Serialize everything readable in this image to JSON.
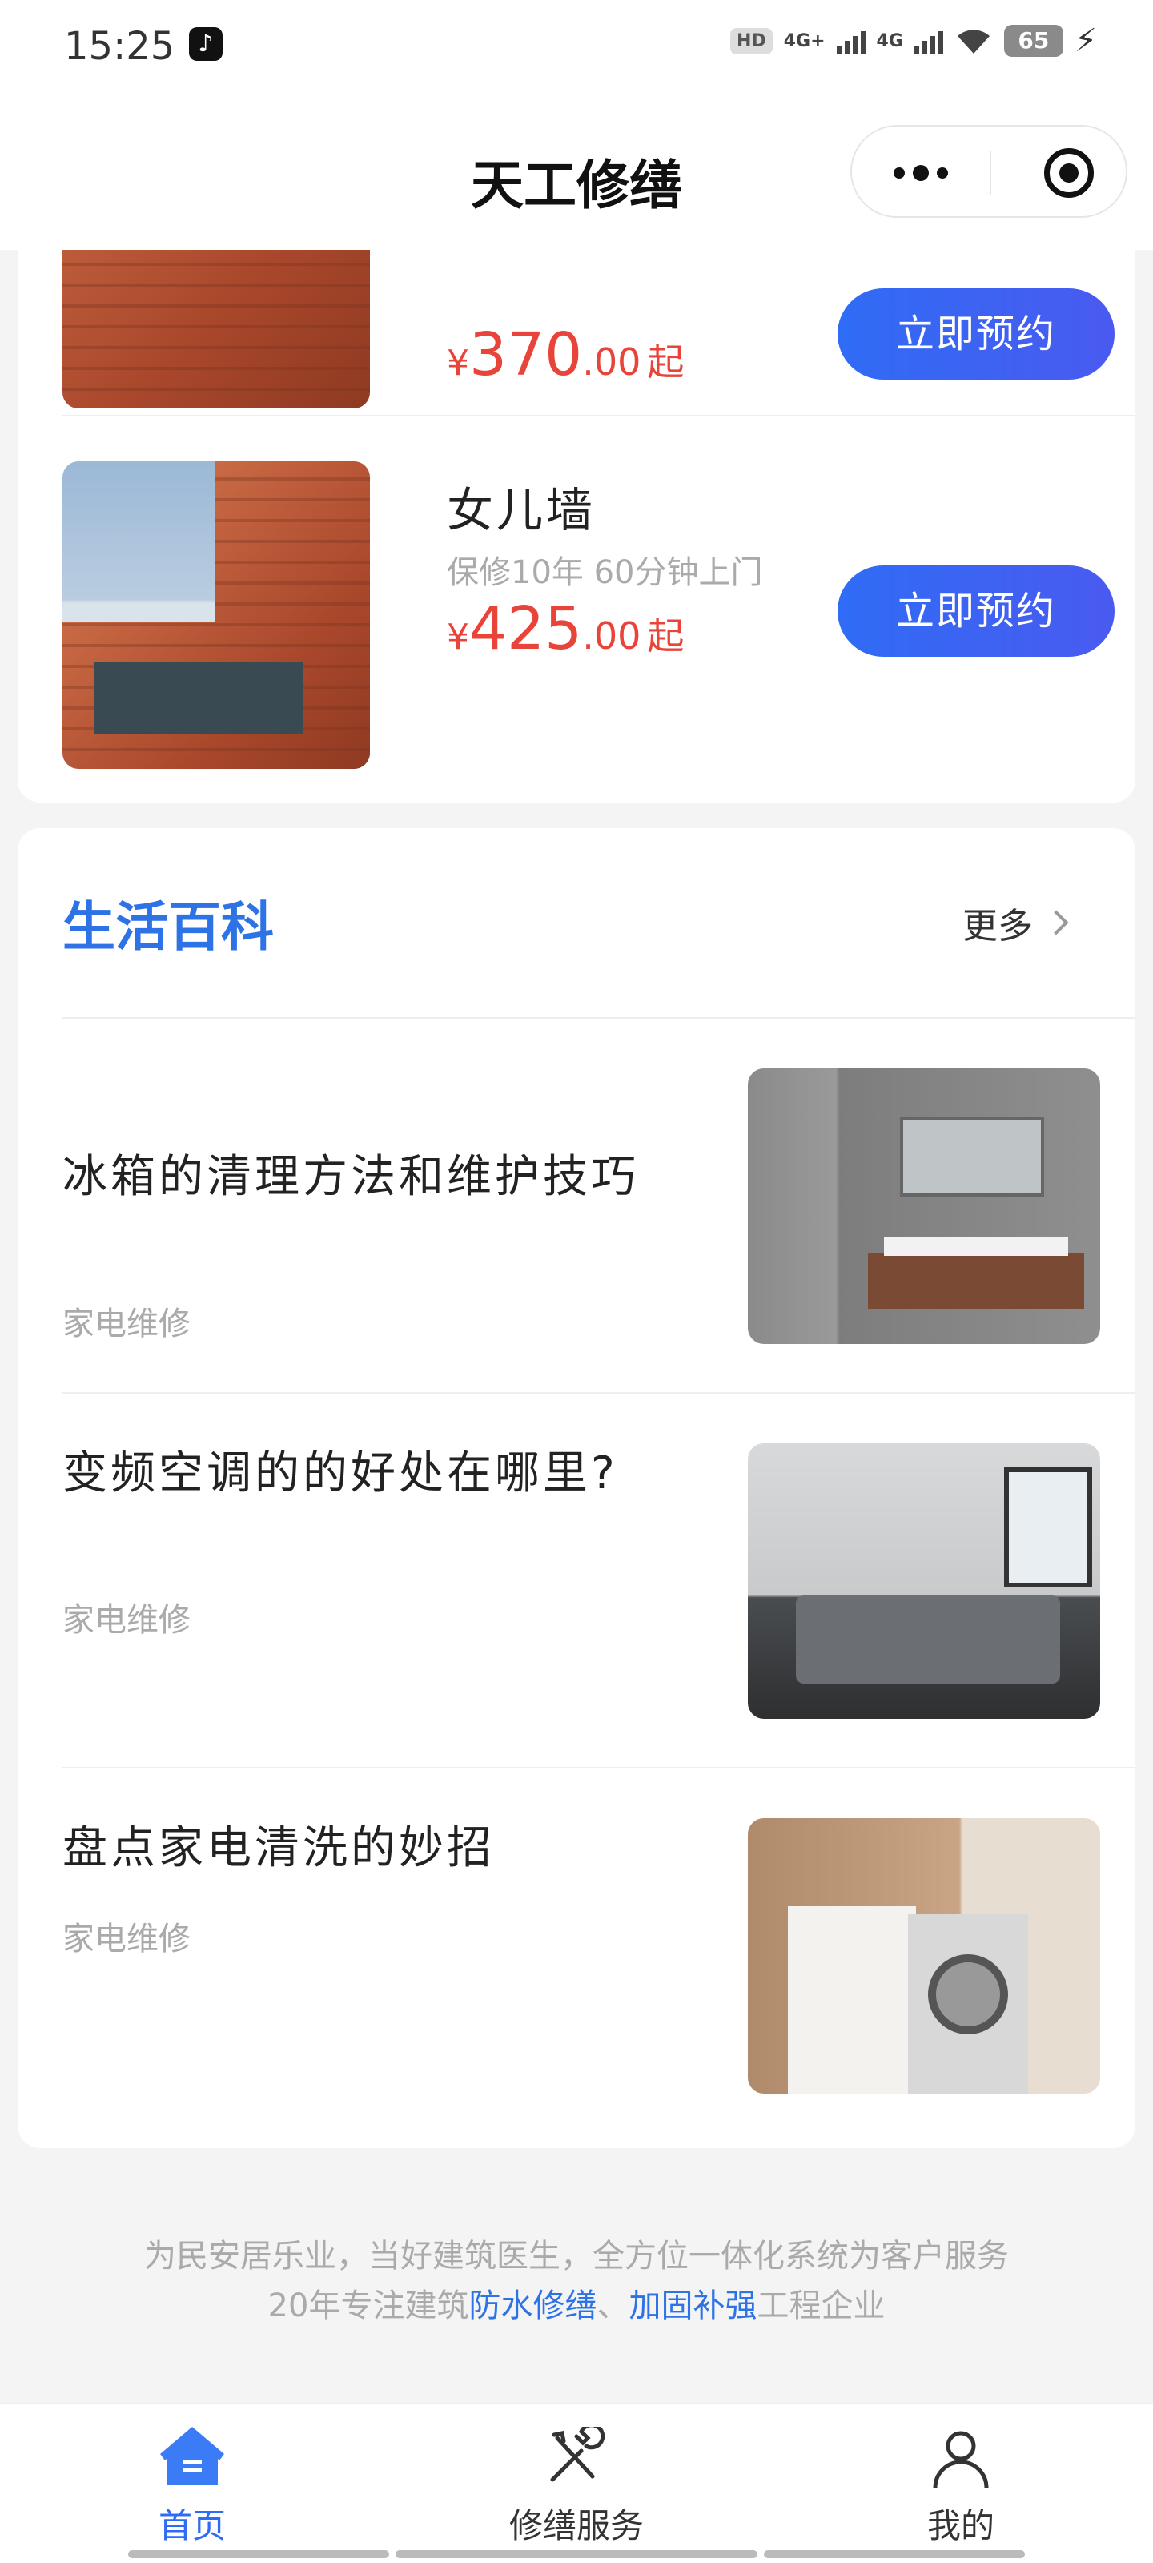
{
  "status_bar": {
    "time": "15:25",
    "app_icon": "tiktok-icon",
    "hd_label": "HD",
    "net1": "4G+",
    "net2": "4G",
    "battery": "65"
  },
  "header": {
    "title": "天工修缮",
    "more_icon": "more-dots-icon",
    "target_icon": "close-target-icon"
  },
  "services": [
    {
      "price_symbol": "¥",
      "price_int": "370",
      "price_dec": ".00",
      "price_suffix": "起",
      "button": "立即预约"
    },
    {
      "name": "女儿墙",
      "subtitle": "保修10年 60分钟上门",
      "price_symbol": "¥",
      "price_int": "425",
      "price_dec": ".00",
      "price_suffix": "起",
      "button": "立即预约"
    }
  ],
  "wiki": {
    "title": "生活百科",
    "more": "更多",
    "articles": [
      {
        "title": "冰箱的清理方法和维护技巧",
        "category": "家电维修"
      },
      {
        "title": "变频空调的的好处在哪里?",
        "category": "家电维修"
      },
      {
        "title": "盘点家电清洗的妙招",
        "category": "家电维修"
      }
    ]
  },
  "footer": {
    "line1": "为民安居乐业，当好建筑医生，全方位一体化系统为客户服务",
    "line2_prefix": "20年专注建筑",
    "line2_hl1": "防水修缮",
    "line2_sep": "、",
    "line2_hl2": "加固补强",
    "line2_suffix": "工程企业"
  },
  "tabbar": {
    "tabs": [
      {
        "label": "首页",
        "icon": "home-icon",
        "active": true
      },
      {
        "label": "修缮服务",
        "icon": "tools-icon",
        "active": false
      },
      {
        "label": "我的",
        "icon": "user-icon",
        "active": false
      }
    ]
  },
  "colors": {
    "accent": "#2f6cf5",
    "price": "#e8443a",
    "wiki_title": "#2d73e6"
  }
}
